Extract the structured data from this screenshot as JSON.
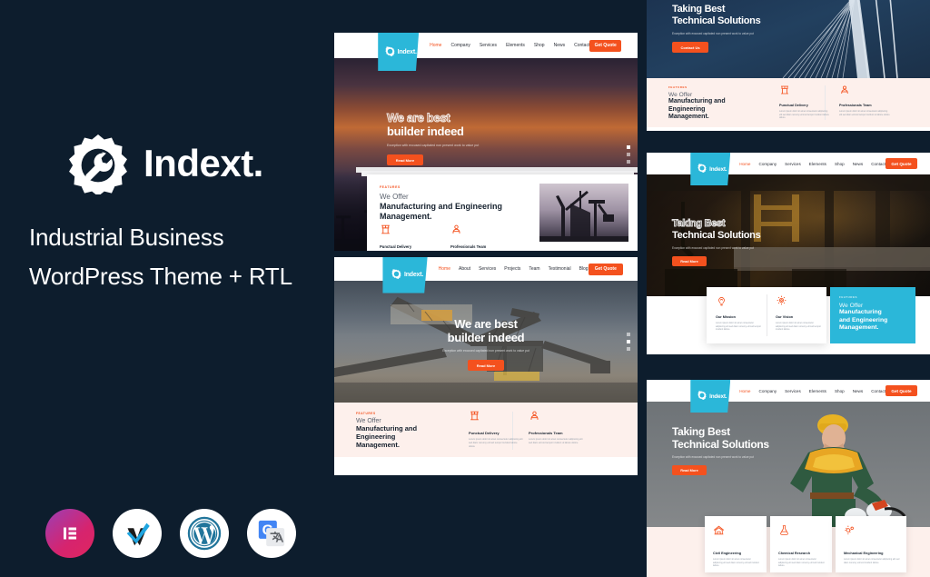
{
  "background_color": "#0d1d2d",
  "accent_orange": "#f4511e",
  "accent_cyan": "#2bb7d9",
  "pink_section": "#fdf0ec",
  "brand": {
    "name": "Indext.",
    "logo_icon": "gear-wrench-icon",
    "tagline_line1": "Industrial Business",
    "tagline_line2": "WordPress Theme + RTL"
  },
  "badges": [
    {
      "name": "elementor",
      "label": "Elementor"
    },
    {
      "name": "wpml",
      "label": "WPML"
    },
    {
      "name": "wordpress",
      "label": "WordPress"
    },
    {
      "name": "google-translate",
      "label": "Google Translate"
    }
  ],
  "nav_primary": {
    "logo": "Indext.",
    "links": [
      {
        "label": "Home",
        "active": true,
        "caret": true
      },
      {
        "label": "Company",
        "active": false,
        "caret": true
      },
      {
        "label": "Services",
        "active": false,
        "caret": true
      },
      {
        "label": "Elements",
        "active": false,
        "caret": true
      },
      {
        "label": "Shop",
        "active": false,
        "caret": true
      },
      {
        "label": "News",
        "active": false,
        "caret": true
      },
      {
        "label": "Contact",
        "active": false,
        "caret": false
      }
    ],
    "cta": "Get Quote"
  },
  "nav_secondary": {
    "logo": "Indext.",
    "links": [
      {
        "label": "Home",
        "active": true,
        "caret": true
      },
      {
        "label": "About",
        "active": false,
        "caret": false
      },
      {
        "label": "Services",
        "active": false,
        "caret": false
      },
      {
        "label": "Projects",
        "active": false,
        "caret": false
      },
      {
        "label": "Team",
        "active": false,
        "caret": false
      },
      {
        "label": "Testimonial",
        "active": false,
        "caret": false
      },
      {
        "label": "Blog",
        "active": false,
        "caret": false
      }
    ],
    "cta": "Get Quote"
  },
  "hero_builder": {
    "title_outline": "We are best",
    "title_solid": "builder indeed",
    "subtitle": "Exception with excused capitated non present work to value put",
    "button": "Read More"
  },
  "hero_technical": {
    "title_line1": "Taking Best",
    "title_line2": "Technical Solutions",
    "subtitle": "Exception with excused capitated non present work to value put",
    "button_contact": "Contact Us",
    "button_read": "Read More"
  },
  "offer_block": {
    "eyebrow": "FEATURES",
    "light_line": "We Offer",
    "bold_line1": "Manufacturing and Engineering",
    "bold_line2": "Management.",
    "bold_stacked": [
      "Manufacturing and",
      "Engineering",
      "Management."
    ],
    "features": [
      {
        "icon": "pillar-icon",
        "title": "Punctual Delivery",
        "desc": "Lorem ipsum dolor sit amet consectetur adipiscing elit sed diam nonumy eirmod tempor invidunt labore dolore"
      },
      {
        "icon": "team-icon",
        "title": "Professionals Team",
        "desc": "Lorem ipsum dolor sit amet consectetur adipiscing elit sed diam eirmod tempor invidunt ut labore dolore"
      }
    ]
  },
  "mission_vision": {
    "items": [
      {
        "icon": "brain-idea-icon",
        "title": "Our Mission",
        "desc": "Lorem ipsum dolor sit amet consectetur adipiscing elit sed diam nonumy eirmod tempor invidunt labore"
      },
      {
        "icon": "gear-vision-icon",
        "title": "Our Vision",
        "desc": "Lorem ipsum dolor sit amet consectetur adipiscing elit sed diam nonumy eirmod tempor invidunt labore"
      }
    ],
    "cyan_panel": {
      "eyebrow": "FEATURES",
      "light_line": "We Offer",
      "bold_lines": [
        "Manufacturing",
        "and Engineering",
        "Management."
      ]
    }
  },
  "services": {
    "cards": [
      {
        "icon": "civil-engineering-icon",
        "title": "Civil Engineering",
        "desc": "Lorem ipsum dolor sit amet consectetur adipiscing elit sed diam nonumy eirmod invidunt labore"
      },
      {
        "icon": "chemical-research-icon",
        "title": "Chemical Research",
        "desc": "Lorem ipsum dolor sit amet consectetur adipiscing elit sed diam nonumy eirmod invidunt labore"
      },
      {
        "icon": "mechanical-engineering-icon",
        "title": "Mechanical Engineering",
        "desc": "Lorem ipsum dolor sit amet consectetur adipiscing elit sed diam nonumy eirmod invidunt labore"
      }
    ]
  }
}
